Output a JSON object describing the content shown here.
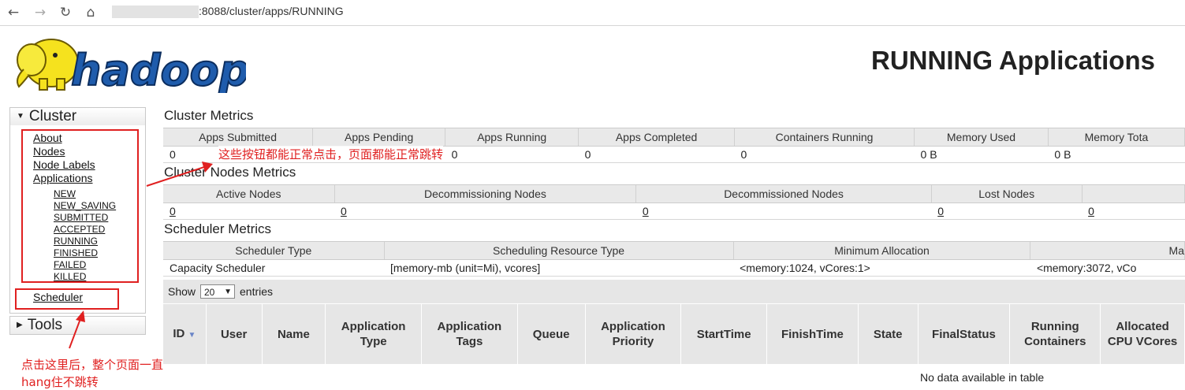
{
  "browser": {
    "back_icon": "arrow-left-icon",
    "forward_icon": "arrow-right-icon",
    "reload_icon": "reload-icon",
    "home_icon": "home-icon",
    "url": ":8088/cluster/apps/RUNNING"
  },
  "header": {
    "logo_text": "hadoop",
    "title": "RUNNING Applications"
  },
  "sidebar": {
    "cluster_label": "Cluster",
    "cluster_links": [
      "About",
      "Nodes",
      "Node Labels",
      "Applications"
    ],
    "app_states": [
      "NEW",
      "NEW_SAVING",
      "SUBMITTED",
      "ACCEPTED",
      "RUNNING",
      "FINISHED",
      "FAILED",
      "KILLED"
    ],
    "scheduler_label": "Scheduler",
    "tools_label": "Tools"
  },
  "cluster_metrics": {
    "title": "Cluster Metrics",
    "headers": [
      "Apps Submitted",
      "Apps Pending",
      "Apps Running",
      "Apps Completed",
      "Containers Running",
      "Memory Used",
      "Memory Tota"
    ],
    "values": [
      "0",
      "0",
      "0",
      "0",
      "0",
      "0 B",
      "0 B"
    ]
  },
  "nodes_metrics": {
    "title": "Cluster Nodes Metrics",
    "headers": [
      "Active Nodes",
      "Decommissioning Nodes",
      "Decommissioned Nodes",
      "Lost Nodes",
      ""
    ],
    "values": [
      "0",
      "0",
      "0",
      "0",
      "0"
    ]
  },
  "scheduler_metrics": {
    "title": "Scheduler Metrics",
    "headers": [
      "Scheduler Type",
      "Scheduling Resource Type",
      "Minimum Allocation",
      "Ma"
    ],
    "values": [
      "Capacity Scheduler",
      "[memory-mb (unit=Mi), vcores]",
      "<memory:1024, vCores:1>",
      "<memory:3072, vCo"
    ]
  },
  "apps_table": {
    "show_label": "Show",
    "entries_value": "20",
    "entries_label": "entries",
    "columns": [
      "ID",
      "User",
      "Name",
      "Application Type",
      "Application Tags",
      "Queue",
      "Application Priority",
      "StartTime",
      "FinishTime",
      "State",
      "FinalStatus",
      "Running Containers",
      "Allocated CPU VCores"
    ],
    "empty_message": "No data available in table"
  },
  "annotations": {
    "note_top": "这些按钮都能正常点击，页面都能正常跳转",
    "note_bottom_1": "点击这里后，整个页面一直",
    "note_bottom_2": "hang住不跳转",
    "color": "#e02020"
  }
}
